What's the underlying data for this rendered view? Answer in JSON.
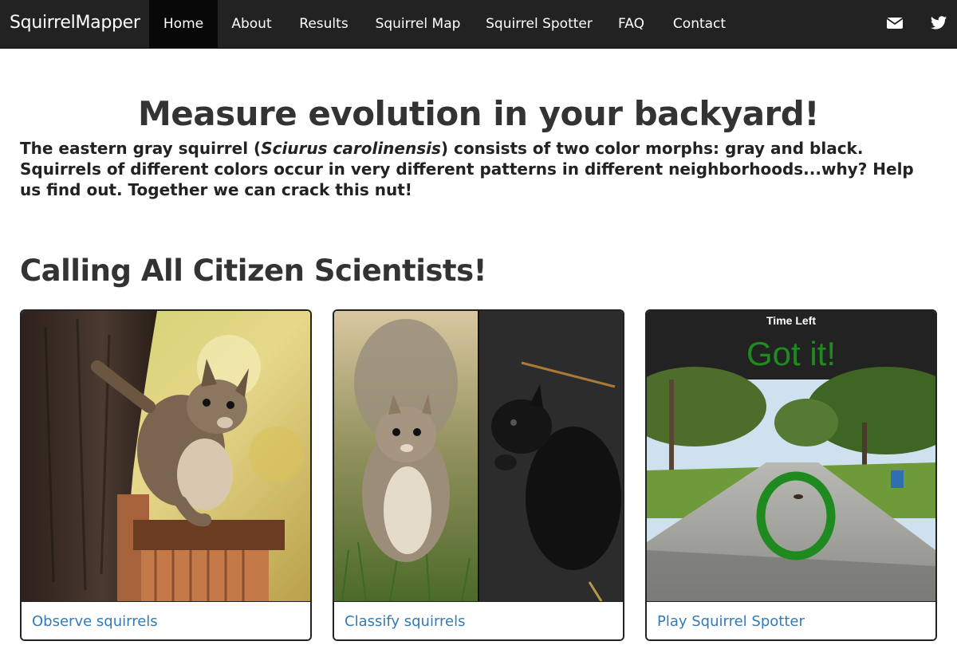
{
  "navbar": {
    "brand": "SquirrelMapper",
    "items": [
      {
        "label": "Home",
        "active": true
      },
      {
        "label": "About",
        "active": false
      },
      {
        "label": "Results",
        "active": false
      },
      {
        "label": "Squirrel Map",
        "active": false
      },
      {
        "label": "Squirrel Spotter",
        "active": false
      },
      {
        "label": "FAQ",
        "active": false
      },
      {
        "label": "Contact",
        "active": false
      }
    ],
    "icons": [
      "envelope-icon",
      "twitter-icon"
    ]
  },
  "hero": {
    "title": "Measure evolution in your backyard!",
    "text_before": "The eastern gray squirrel (",
    "species": "Sciurus carolinensis",
    "text_after": ") consists of two color morphs: gray and black. Squirrels of different colors occur in very different patterns in different neighborhoods...why? Help us find out. Together we can crack this nut!"
  },
  "section": {
    "title": "Calling All Citizen Scientists!"
  },
  "cards": [
    {
      "link": "Observe squirrels",
      "image": "squirrel-on-tree-photo"
    },
    {
      "link": "Classify squirrels",
      "image": "gray-and-black-squirrels-photo"
    },
    {
      "link": "Play Squirrel Spotter",
      "image": "squirrel-spotter-game-screenshot",
      "timer_label": "Time Left",
      "status": "Got it!"
    }
  ],
  "colors": {
    "navbar_bg": "#222222",
    "nav_active_bg": "#080808",
    "link": "#337ab7",
    "status_green": "#1f8a1f"
  }
}
